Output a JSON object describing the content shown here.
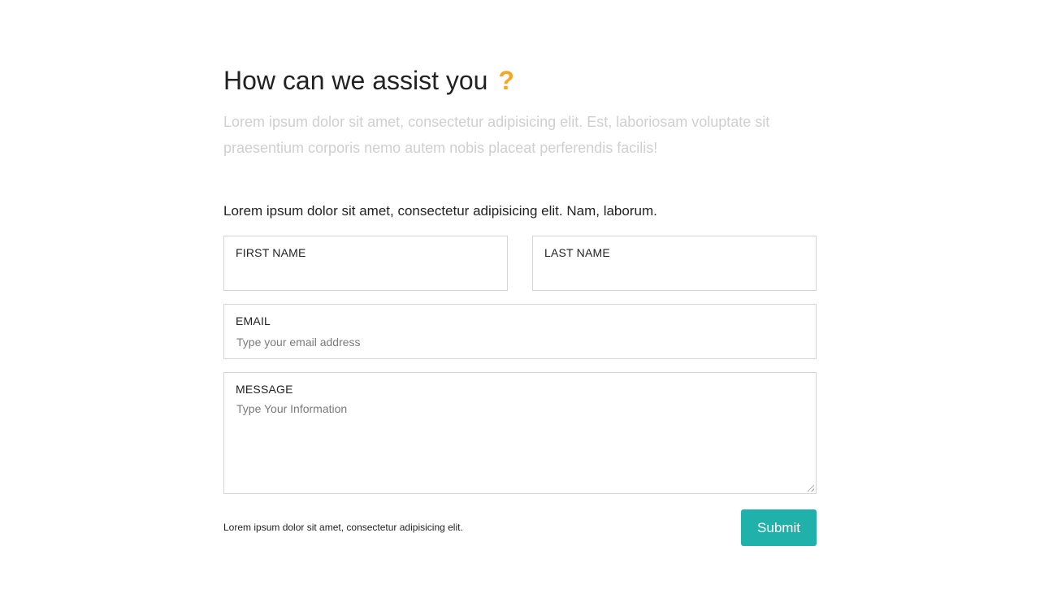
{
  "header": {
    "title": "How can we assist you",
    "title_accent": "?",
    "intro": "Lorem ipsum dolor sit amet, consectetur adipisicing elit. Est, laboriosam voluptate sit praesentium corporis nemo autem nobis placeat perferendis facilis!"
  },
  "form": {
    "lead": "Lorem ipsum dolor sit amet, consectetur adipisicing elit. Nam, laborum.",
    "first_name": {
      "label": "FIRST NAME",
      "value": "",
      "placeholder": ""
    },
    "last_name": {
      "label": "LAST NAME",
      "value": "",
      "placeholder": ""
    },
    "email": {
      "label": "EMAIL",
      "value": "",
      "placeholder": "Type your email address"
    },
    "message": {
      "label": "MESSAGE",
      "value": "",
      "placeholder": "Type Your Information"
    },
    "footnote": "Lorem ipsum dolor sit amet, consectetur adipisicing elit.",
    "submit_label": "Submit"
  },
  "colors": {
    "accent": "#f5a623",
    "button": "#20b2aa",
    "muted_text": "#cfcfcf"
  },
  "icons": {
    "textarea_grip": "resize-grip-icon"
  }
}
